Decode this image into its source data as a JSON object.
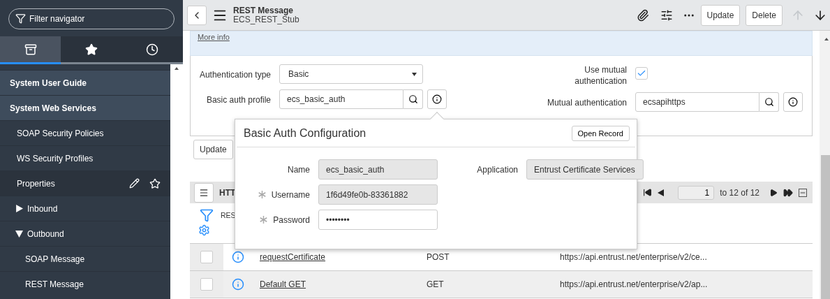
{
  "sidebar": {
    "filter": {
      "placeholder": "Filter navigator"
    },
    "tabs": [
      {
        "kind": "all",
        "selected": true
      },
      {
        "kind": "favorites",
        "selected": false
      },
      {
        "kind": "history",
        "selected": false
      }
    ],
    "items": [
      {
        "label": "System User Guide",
        "kind": "group"
      },
      {
        "label": "System Web Services",
        "kind": "group",
        "children": [
          {
            "label": "SOAP Security Policies",
            "kind": "module",
            "highlighted": false
          },
          {
            "label": "WS Security Profiles",
            "kind": "module",
            "highlighted": false
          },
          {
            "label": "Properties",
            "kind": "module",
            "highlighted": true
          },
          {
            "label": "Inbound",
            "kind": "folder",
            "expanded": false
          },
          {
            "label": "Outbound",
            "kind": "folder",
            "expanded": true,
            "children": [
              {
                "label": "SOAP Message",
                "kind": "module",
                "highlighted": false
              },
              {
                "label": "REST Message",
                "kind": "module",
                "highlighted": false
              }
            ]
          }
        ]
      }
    ]
  },
  "header": {
    "title": "REST Message",
    "subtitle": "ECS_REST_Stub",
    "buttons": [
      "Update",
      "Delete"
    ],
    "previous_disabled": true,
    "next_disabled": false
  },
  "form": {
    "more_info": "More info",
    "auth_type": {
      "label": "Authentication type",
      "value": "Basic"
    },
    "basic_auth_profile": {
      "label": "Basic auth profile",
      "value": "ecs_basic_auth"
    },
    "mutual_auth": {
      "label": "Use mutual authentication",
      "checked": true
    },
    "mutual_auth_profile": {
      "label": "Mutual authentication",
      "value": "ecsapihttps"
    },
    "update_button": "Update"
  },
  "popover": {
    "title": "Basic Auth Configuration",
    "open_record": "Open Record",
    "fields": [
      {
        "label": "Name",
        "value": "ecs_basic_auth",
        "required": false,
        "readonly": true
      },
      {
        "label": "Username",
        "value": "1f6d49fe0b-83361882",
        "required": true,
        "readonly": true
      },
      {
        "label": "Password",
        "value": "••••••••",
        "required": true,
        "readonly": false
      }
    ],
    "application": {
      "label": "Application",
      "value": "Entrust Certificate Services"
    }
  },
  "list": {
    "title": "HTT",
    "breadcrumb": "RES",
    "page": "1",
    "range": "to 12 of 12",
    "rows": [
      {
        "name": "requestCertificate",
        "method": "POST",
        "url": "https://api.entrust.net/enterprise/v2/ce...",
        "checked": false
      },
      {
        "name": "Default GET",
        "method": "GET",
        "url": "https://api.entrust.net/enterprise/v2/ap...",
        "checked": false
      }
    ]
  }
}
